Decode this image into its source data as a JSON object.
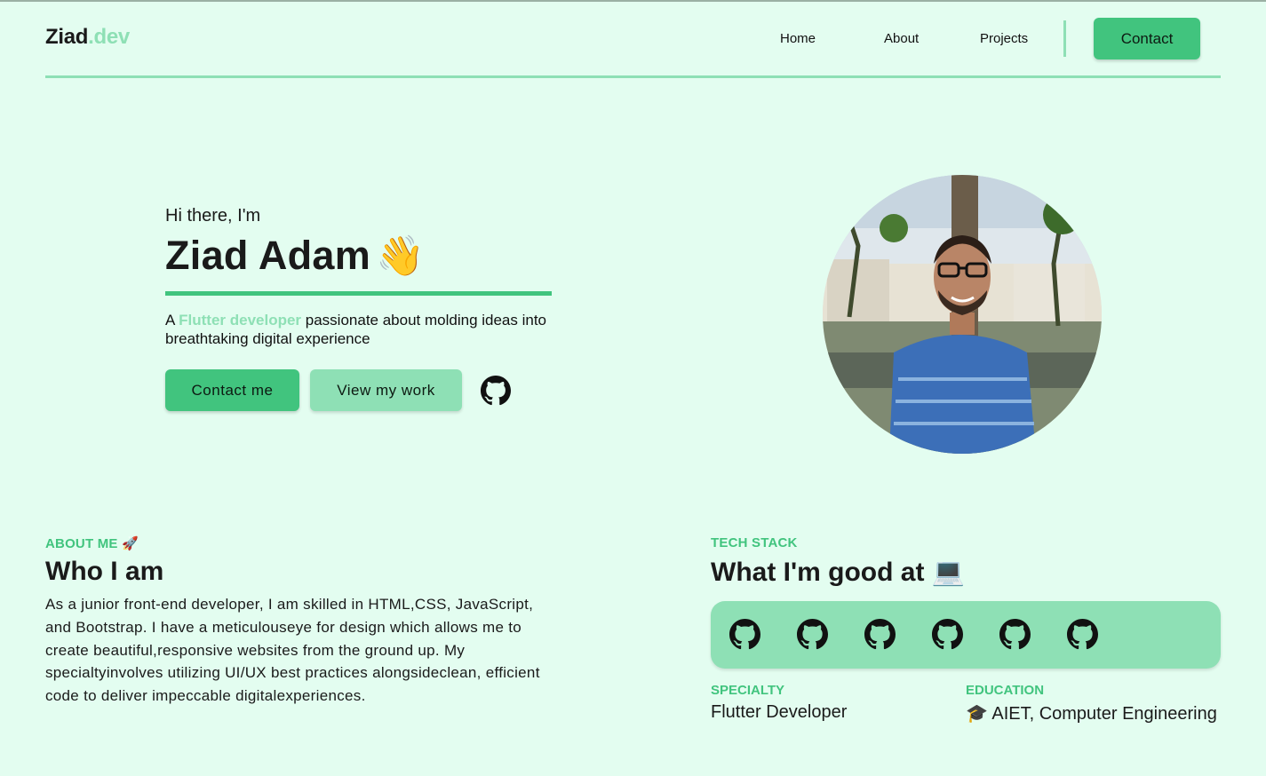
{
  "header": {
    "logo_main": "Ziad",
    "logo_tld": ".dev",
    "nav": [
      {
        "label": "Home"
      },
      {
        "label": "About"
      },
      {
        "label": "Projects"
      }
    ],
    "contact_label": "Contact"
  },
  "hero": {
    "greeting": "Hi there, I'm",
    "name": "Ziad Adam",
    "name_emoji": "👋",
    "tagline_prefix": "A ",
    "tagline_highlight": "Flutter developer",
    "tagline_suffix": " passionate about molding ideas into breathtaking digital experience",
    "contact_button": "Contact me",
    "work_button": "View my work",
    "github_icon": "github-icon"
  },
  "about": {
    "eyebrow": "ABOUT ME 🚀",
    "title": "Who I am",
    "body": "As a junior front-end developer, I am skilled in HTML,CSS, JavaScript, and Bootstrap. I have a meticulouseye for design which allows me to create beautiful,responsive websites from the ground up. My specialtyinvolves utilizing UI/UX best practices alongsideclean, efficient code to deliver impeccable digitalexperiences."
  },
  "tech": {
    "eyebrow": "TECH STACK",
    "title": "What I'm good at 💻",
    "icons": [
      "github-icon",
      "github-icon",
      "github-icon",
      "github-icon",
      "github-icon",
      "github-icon"
    ],
    "specialty_label": "SPECIALTY",
    "specialty_value": "Flutter Developer",
    "education_label": "EDUCATION",
    "education_value": "🎓 AIET, Computer Engineering"
  },
  "colors": {
    "background": "#e3fdf0",
    "accent": "#41c47e",
    "accent_light": "#8ee0b5",
    "text": "#1a1a1a"
  }
}
